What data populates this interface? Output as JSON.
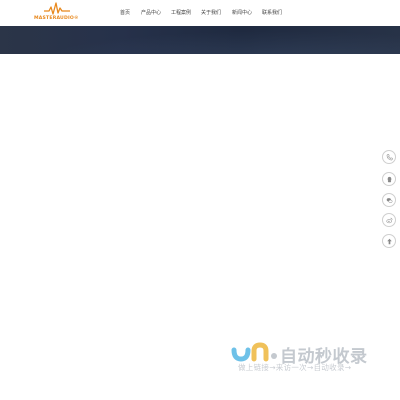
{
  "logo": {
    "brand_text": "MASTERAUDIO®",
    "icon": "waveform-logo-icon",
    "color": "#e8891e"
  },
  "nav": {
    "items": [
      {
        "label": "首页"
      },
      {
        "label": "产品中心"
      },
      {
        "label": "工程案例"
      },
      {
        "label": "关于我们"
      },
      {
        "label": "新闻中心"
      },
      {
        "label": "联系我们"
      }
    ]
  },
  "banner": {
    "color": "#232e44"
  },
  "float_buttons": [
    {
      "icon": "phone-icon"
    },
    {
      "icon": "qq-icon"
    },
    {
      "icon": "wechat-icon"
    },
    {
      "icon": "weibo-icon"
    },
    {
      "icon": "back-to-top-icon"
    }
  ],
  "watermark": {
    "title": "自动秒收录",
    "subtitle": "做上链接→来访一次→自动收录→"
  }
}
